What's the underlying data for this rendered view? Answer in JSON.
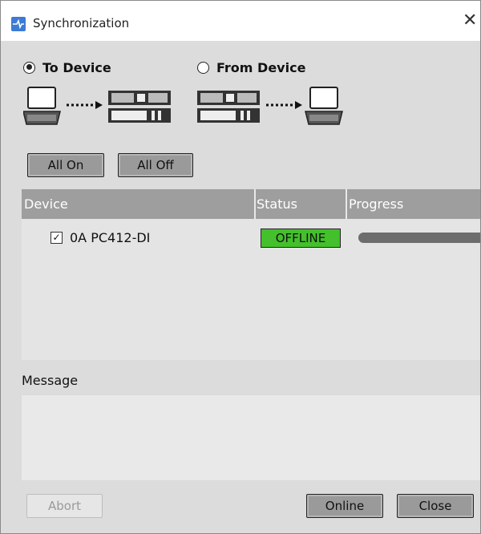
{
  "window": {
    "title": "Synchronization"
  },
  "direction": {
    "to_device": {
      "label": "To Device",
      "selected": true
    },
    "from_device": {
      "label": "From Device",
      "selected": false
    }
  },
  "buttons": {
    "all_on": "All On",
    "all_off": "All Off",
    "abort": "Abort",
    "online": "Online",
    "close": "Close"
  },
  "table": {
    "headers": {
      "device": "Device",
      "status": "Status",
      "progress": "Progress"
    },
    "rows": [
      {
        "checked": true,
        "device": "0A PC412-DI",
        "status": "OFFLINE",
        "status_color": "#44c02c",
        "progress": 0
      }
    ]
  },
  "message": {
    "label": "Message",
    "text": ""
  }
}
